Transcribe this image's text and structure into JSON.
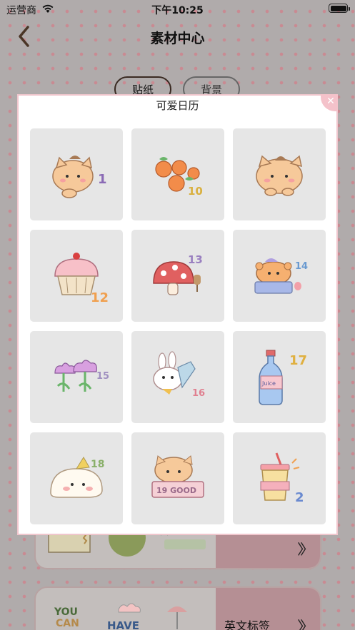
{
  "status_bar": {
    "carrier": "运营商",
    "time": "下午10:25"
  },
  "nav": {
    "title": "素材中心"
  },
  "tabs": [
    {
      "label": "贴纸",
      "active": true
    },
    {
      "label": "背景",
      "active": false
    }
  ],
  "cards": [
    {
      "label": "",
      "text_snippets": []
    },
    {
      "label": "英文标签",
      "text_snippets": [
        "YOU",
        "CAN",
        "HAVE"
      ]
    }
  ],
  "modal": {
    "title": "可爱日历",
    "items": [
      {
        "name": "cat-sticker",
        "number": "1"
      },
      {
        "name": "oranges-sticker",
        "number": "10"
      },
      {
        "name": "cat-sticker",
        "number": ""
      },
      {
        "name": "cupcake-sticker",
        "number": "12"
      },
      {
        "name": "mushroom-sticker",
        "number": "13"
      },
      {
        "name": "bear-sticker",
        "number": "14"
      },
      {
        "name": "flowers-sticker",
        "number": "15"
      },
      {
        "name": "bunny-sticker",
        "number": "16"
      },
      {
        "name": "juice-sticker",
        "number": "17",
        "bottle_text": "Juice"
      },
      {
        "name": "puppy-sticker",
        "number": "18"
      },
      {
        "name": "cat-good-sticker",
        "number": "",
        "sign_text": "19 GOOD"
      },
      {
        "name": "drink-cup-sticker",
        "number": "2"
      }
    ]
  },
  "colors": {
    "accent_pink": "#f0c6cd",
    "dots": "#c98a92",
    "overlay_bg": "#b0abab"
  }
}
